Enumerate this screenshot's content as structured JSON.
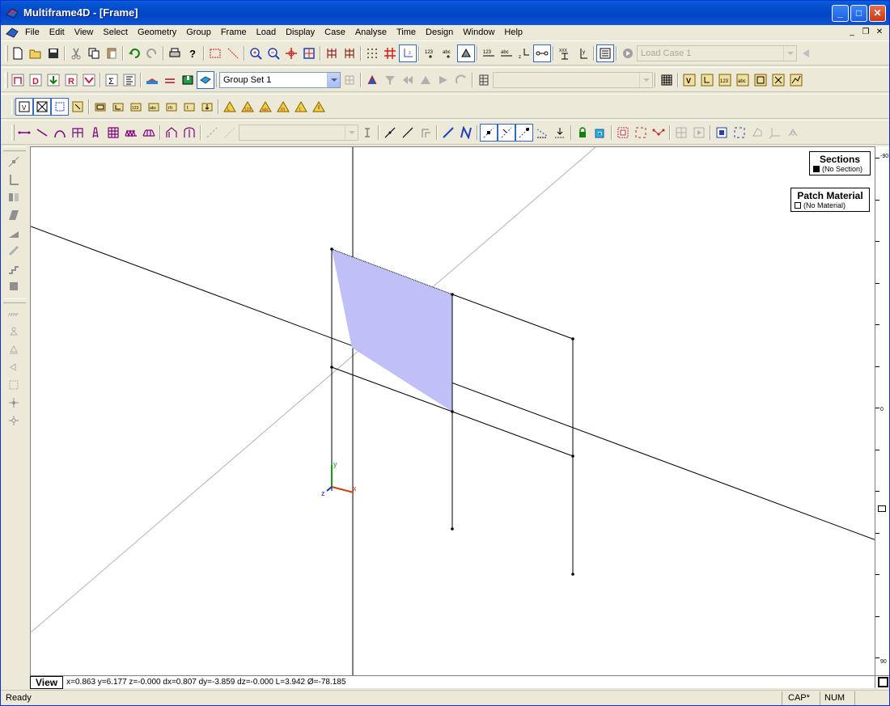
{
  "window": {
    "title": "Multiframe4D - [Frame]"
  },
  "caption_buttons": {
    "minimize": "_",
    "maximize": "□",
    "close": "✕"
  },
  "menu": [
    "File",
    "Edit",
    "View",
    "Select",
    "Geometry",
    "Group",
    "Frame",
    "Load",
    "Display",
    "Case",
    "Analyse",
    "Time",
    "Design",
    "Window",
    "Help"
  ],
  "mdi_buttons": {
    "minimize": "_",
    "restore": "❐",
    "close": "✕"
  },
  "toolbar": {
    "load_case": "Load Case 1",
    "group_set": "Group Set 1",
    "numbering_label": "123",
    "abc_label": "abc",
    "xxx_label": "XXX"
  },
  "legend_sections": {
    "title": "Sections",
    "item": "(No Section)"
  },
  "legend_patch": {
    "title": "Patch Material",
    "item": "(No Material)"
  },
  "axis_labels": {
    "x": "x",
    "y": "y",
    "z": "z"
  },
  "ruler": {
    "top_label": "-90",
    "mid_label": "0",
    "bottom_label": "90"
  },
  "coordbar": {
    "view_label": "View",
    "coords": "x=0.863 y=6.177 z=-0.000 dx=0.807 dy=-3.859 dz=-0.000 L=3.942 Ø=-78.185"
  },
  "status": {
    "text": "Ready",
    "cap": "CAP*",
    "num": "NUM"
  },
  "colors": {
    "patch_fill": "#c0c0f8",
    "titlebar": "#0450d0",
    "axis_x": "#d04010",
    "axis_y": "#10a010",
    "axis_z": "#2030c0"
  }
}
